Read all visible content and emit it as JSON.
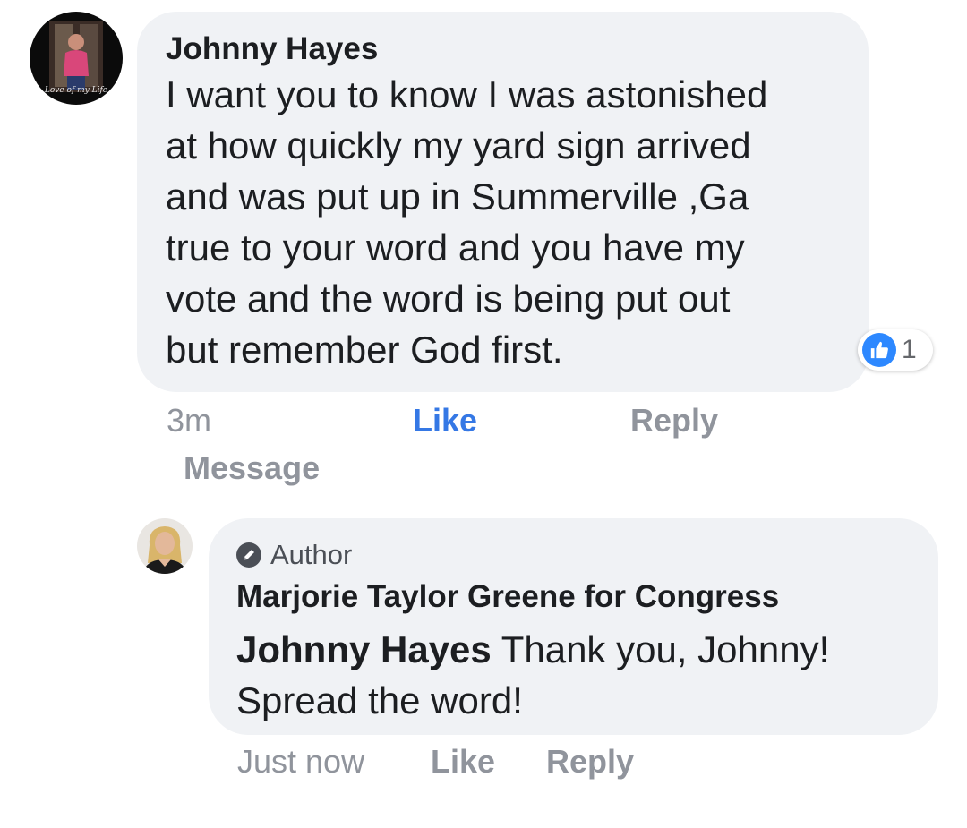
{
  "comment": {
    "author": "Johnny Hayes",
    "avatar_icon": "profile-photo",
    "avatar_caption": "Love of my Life",
    "text_lines": [
      "I want you to know I was astonished",
      "at how quickly my yard sign arrived",
      "and was put up in Summerville ,Ga",
      "true to your word and you have my",
      "vote and the word is being put out",
      "but remember God first."
    ],
    "reactions": {
      "icon": "thumbs-up-icon",
      "count": "1",
      "color": "#2d88ff"
    },
    "actions": {
      "time": "3m",
      "like": "Like",
      "reply": "Reply",
      "message": "Message"
    },
    "like_active_color": "#3578e5"
  },
  "reply": {
    "badge_icon": "pencil-icon",
    "badge_label": "Author",
    "page_name": "Marjorie Taylor Greene for Congress",
    "avatar_icon": "profile-photo",
    "mention": "Johnny Hayes",
    "text_first": " Thank you, Johnny!",
    "text_second": "Spread the word!",
    "actions": {
      "time": "Just now",
      "like": "Like",
      "reply": "Reply"
    }
  },
  "colors": {
    "bubble": "#f0f2f5",
    "text": "#1c1e21",
    "muted": "#90949c"
  }
}
